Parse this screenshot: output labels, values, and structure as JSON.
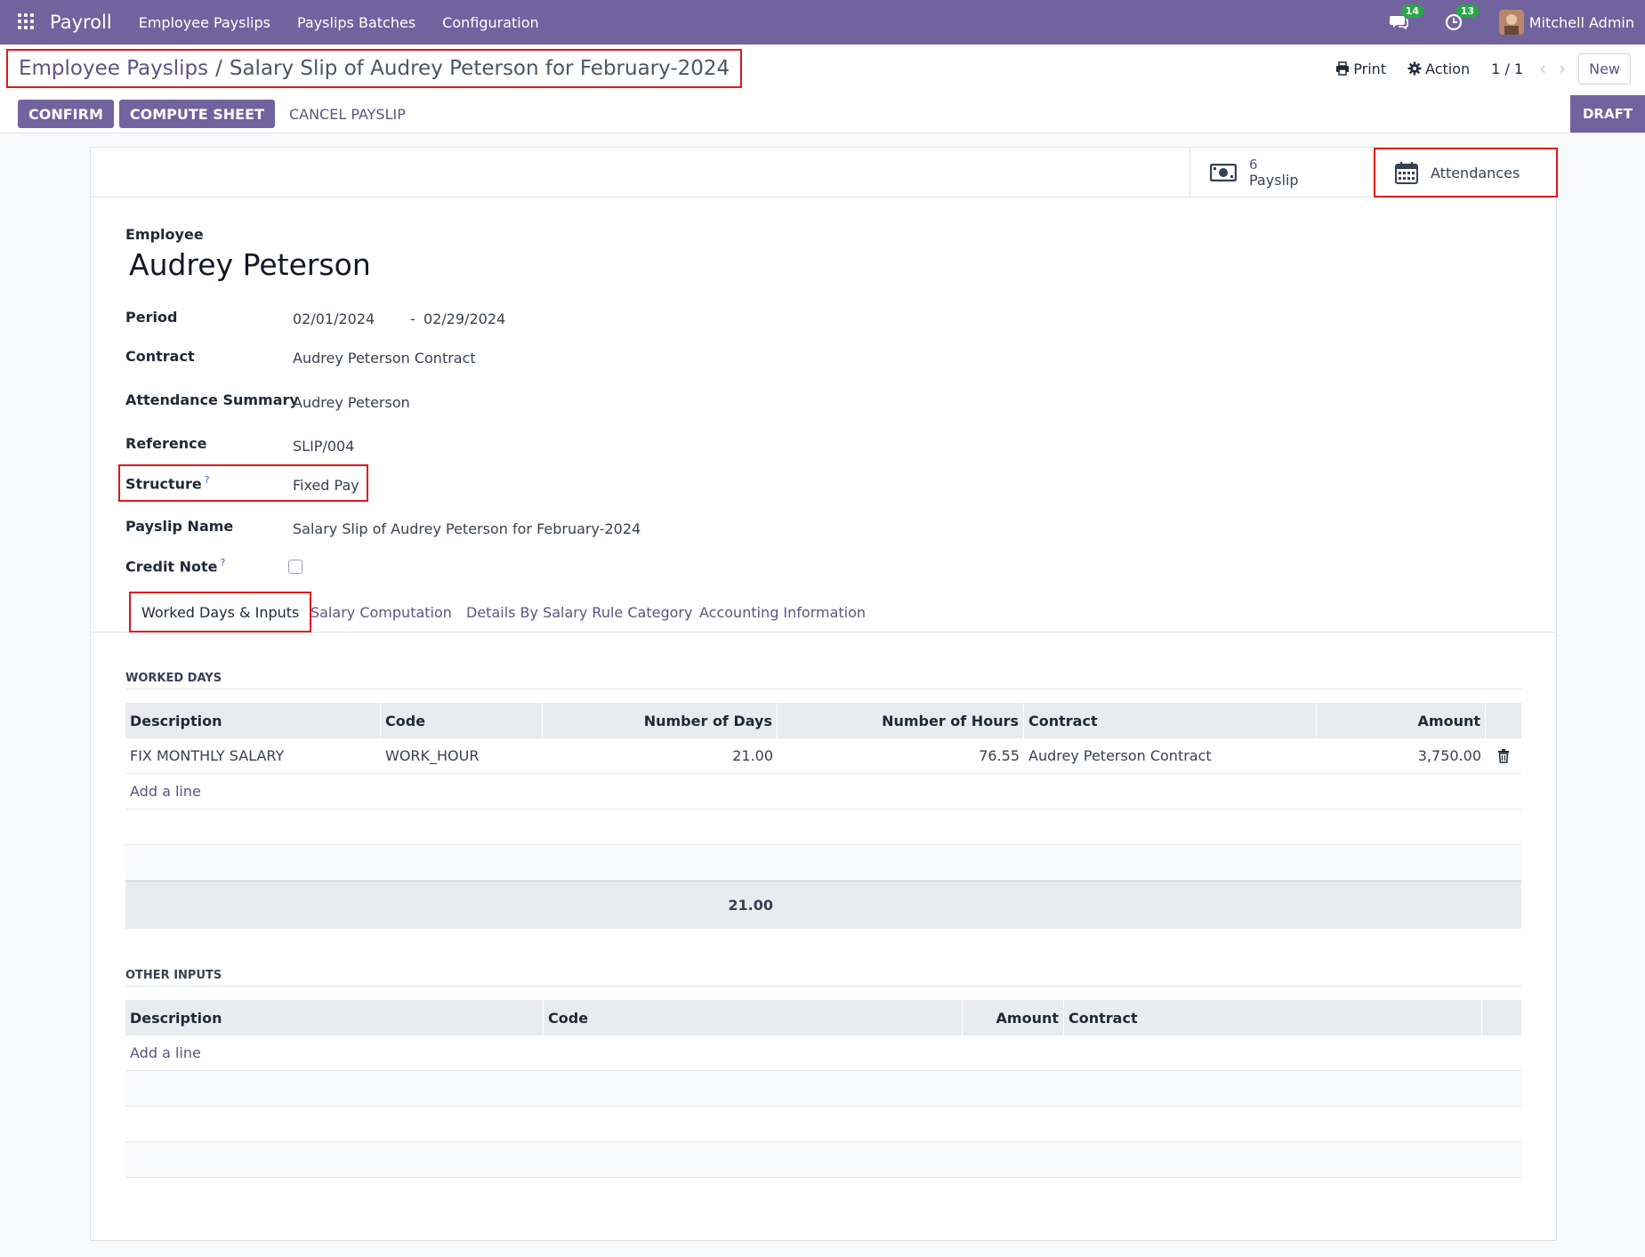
{
  "navbar": {
    "app_name": "Payroll",
    "menu": [
      "Employee Payslips",
      "Payslips Batches",
      "Configuration"
    ],
    "messages_count": "14",
    "activities_count": "13",
    "user_name": "Mitchell Admin",
    "brand_color": "#71639e"
  },
  "control_panel": {
    "breadcrumb_parent": "Employee Payslips",
    "breadcrumb_separator": "/",
    "breadcrumb_current": "Salary Slip of Audrey Peterson for February-2024",
    "print_label": "Print",
    "action_label": "Action",
    "pager": "1 / 1",
    "new_label": "New"
  },
  "actions": {
    "confirm": "CONFIRM",
    "compute_sheet": "COMPUTE SHEET",
    "cancel_payslip": "CANCEL PAYSLIP",
    "status": "DRAFT"
  },
  "smart_buttons": {
    "payslip_count": "6",
    "payslip_label": "Payslip",
    "attendances_label": "Attendances"
  },
  "form": {
    "employee_label": "Employee",
    "employee_name": "Audrey Peterson",
    "period_label": "Period",
    "period_from": "02/01/2024",
    "period_dash": "-",
    "period_to": "02/29/2024",
    "contract_label": "Contract",
    "contract_value": "Audrey Peterson Contract",
    "attendance_summary_label": "Attendance Summary",
    "attendance_summary_value": "Audrey Peterson",
    "reference_label": "Reference",
    "reference_value": "SLIP/004",
    "structure_label": "Structure",
    "structure_value": "Fixed Pay",
    "payslip_name_label": "Payslip Name",
    "payslip_name_value": "Salary Slip of Audrey Peterson for February-2024",
    "credit_note_label": "Credit Note",
    "help_mark": "?"
  },
  "tabs": [
    "Worked Days & Inputs",
    "Salary Computation",
    "Details By Salary Rule Category",
    "Accounting Information"
  ],
  "worked_days": {
    "title": "WORKED DAYS",
    "columns": [
      "Description",
      "Code",
      "Number of Days",
      "Number of Hours",
      "Contract",
      "Amount"
    ],
    "rows": [
      {
        "description": "FIX MONTHLY SALARY",
        "code": "WORK_HOUR",
        "days": "21.00",
        "hours": "76.55",
        "contract": "Audrey Peterson Contract",
        "amount": "3,750.00"
      }
    ],
    "add_line": "Add a line",
    "total_days": "21.00"
  },
  "other_inputs": {
    "title": "OTHER INPUTS",
    "columns": [
      "Description",
      "Code",
      "Amount",
      "Contract"
    ],
    "add_line": "Add a line"
  }
}
